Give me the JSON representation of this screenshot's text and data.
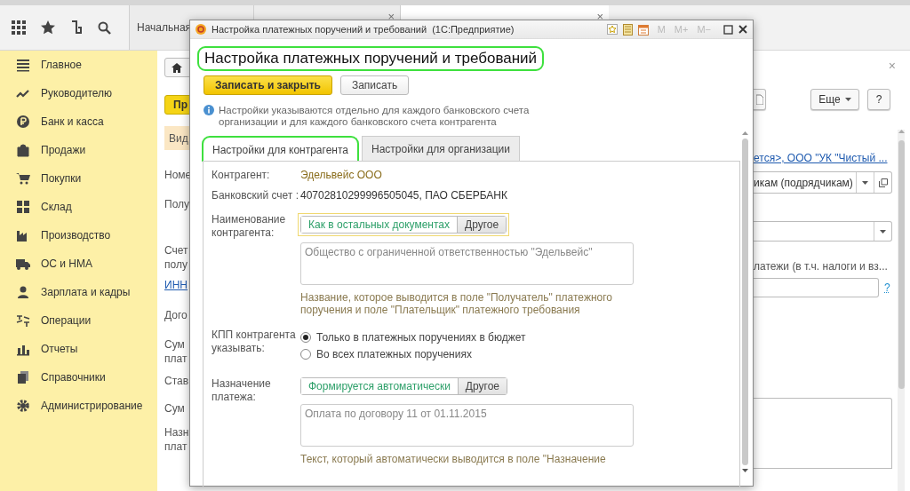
{
  "top_bar": {
    "tabs": [
      {
        "label": "Начальная",
        "selected": false
      },
      {
        "close": "×",
        "selected": false
      },
      {
        "close": "×",
        "selected": true
      }
    ]
  },
  "sidebar": {
    "items": [
      {
        "label": "Главное"
      },
      {
        "label": "Руководителю"
      },
      {
        "label": "Банк и касса"
      },
      {
        "label": "Продажи"
      },
      {
        "label": "Покупки"
      },
      {
        "label": "Склад"
      },
      {
        "label": "Производство"
      },
      {
        "label": "ОС и НМА"
      },
      {
        "label": "Зарплата и кадры"
      },
      {
        "label": "Операции"
      },
      {
        "label": "Отчеты"
      },
      {
        "label": "Справочники"
      },
      {
        "label": "Администрирование"
      }
    ]
  },
  "background_form": {
    "left_fragments": [
      {
        "kind": "button",
        "text": "Пр"
      },
      {
        "kind": "banner",
        "text": "Вид"
      },
      {
        "kind": "label",
        "text": "Номе"
      },
      {
        "kind": "label",
        "text": "Полу"
      },
      {
        "kind": "label",
        "text": "Счет полу"
      },
      {
        "kind": "link",
        "text": "ИНН"
      },
      {
        "kind": "label",
        "text": "Дого"
      },
      {
        "kind": "label",
        "text": "Сум плат"
      },
      {
        "kind": "label",
        "text": "Став"
      },
      {
        "kind": "label",
        "text": "Сум"
      },
      {
        "kind": "label",
        "text": "Назн плат"
      }
    ],
    "close": "×",
    "more_button": "Еще",
    "help_button": "?",
    "recipient_link": "ется>, ООО \"УК \"Чистый ...",
    "operation_combo": "икам (подрядчикам)",
    "payments_label": "латежи (в т.ч. налоги и вз...",
    "help_link": "?"
  },
  "dialog": {
    "title": "Настройка платежных поручений и требований  (1С:Предприятие)",
    "memory_buttons": [
      {
        "label": "M",
        "disabled": true
      },
      {
        "label": "M+",
        "disabled": true
      },
      {
        "label": "M−",
        "disabled": true
      }
    ],
    "heading": {
      "text": "Настройка платежных поручений и требований",
      "highlighted": true
    },
    "buttons": [
      {
        "label": "Записать и закрыть",
        "kind": "primary"
      },
      {
        "label": "Записать",
        "kind": "normal"
      }
    ],
    "info": "Настройки указываются отдельно для каждого банковского счета организации и для каждого банковского счета контрагента",
    "tabs": [
      {
        "label": "Настройки для контрагента",
        "selected": true,
        "highlighted": true
      },
      {
        "label": "Настройки для организации",
        "selected": false,
        "highlighted": false
      }
    ],
    "counterparty": {
      "label": "Контрагент:",
      "value": "Эдельвейс ООО"
    },
    "bank_account": {
      "label": "Банковский счет :",
      "value": "40702810299996505045, ПАО СБЕРБАНК"
    },
    "name_section": {
      "label": "Наименование контрагента:",
      "focused": true,
      "options": [
        {
          "label": "Как в остальных документах",
          "selected": true
        },
        {
          "label": "Другое",
          "selected": false
        }
      ],
      "value": "Общество с ограниченной ответственностью \"Эдельвейс\"",
      "hint": "Название, которое выводится в поле \"Получатель\" платежного поручения и поле \"Плательщик\" платежного требования"
    },
    "kpp": {
      "label": "КПП контрагента указывать:",
      "options": [
        {
          "label": "Только в платежных поручениях в бюджет",
          "selected": true
        },
        {
          "label": "Во всех платежных поручениях",
          "selected": false
        }
      ]
    },
    "purpose": {
      "label": "Назначение платежа:",
      "focused": false,
      "options": [
        {
          "label": "Формируется автоматически",
          "selected": true
        },
        {
          "label": "Другое",
          "selected": false
        }
      ],
      "value": "Оплата по договору 11 от 01.11.2015",
      "hint": "Текст, который автоматически выводится в поле \"Назначение"
    }
  }
}
